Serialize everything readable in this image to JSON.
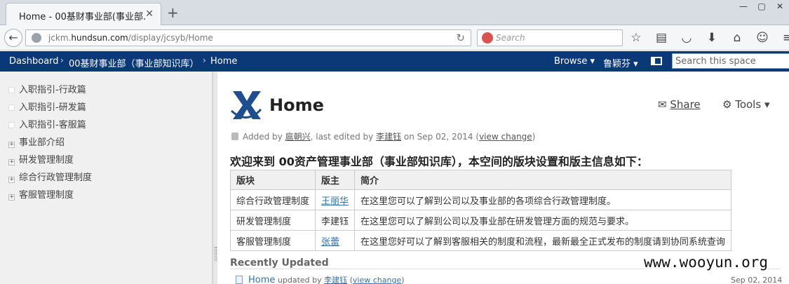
{
  "browser": {
    "tab_title": "Home - 00基财事业部(事业部...",
    "tab_close": "✕",
    "new_tab": "+",
    "url_prefix": "jckm.",
    "url_domain": "hundsun.com",
    "url_path": "/display/jcsyb/Home",
    "search_placeholder": "Search",
    "back_icon": "←",
    "reload_icon": "↻"
  },
  "header": {
    "breadcrumbs": [
      "Dashboard",
      "00基财事业部（事业部知识库）",
      "Home"
    ],
    "breadcrumb_sep": "›",
    "browse_label": "Browse ▾",
    "user_label": "鲁颖芬 ▾",
    "search_placeholder": "Search this space"
  },
  "sidebar": {
    "items": [
      {
        "label": "入职指引-行政篇",
        "marker": ""
      },
      {
        "label": "入职指引-研发篇",
        "marker": ""
      },
      {
        "label": "入职指引-客服篇",
        "marker": ""
      },
      {
        "label": "事业部介绍",
        "marker": "+"
      },
      {
        "label": "研发管理制度",
        "marker": "+"
      },
      {
        "label": "综合行政管理制度",
        "marker": "+"
      },
      {
        "label": "客服管理制度",
        "marker": "+"
      }
    ]
  },
  "page": {
    "title": "Home",
    "share_label": "Share",
    "tools_label": "Tools ▾",
    "meta_added": "Added by ",
    "meta_author": "扈朝兴",
    "meta_edited": ", last edited by ",
    "meta_editor": "李建钰",
    "meta_date": " on Sep 02, 2014  (",
    "meta_view_change": "view change",
    "meta_close": ")",
    "heading": "欢迎来到 00资产管理事业部（事业部知识库），本空间的版块设置和版主信息如下："
  },
  "table": {
    "headers": [
      "版块",
      "版主",
      "简介"
    ],
    "rows": [
      {
        "section": "综合行政管理制度",
        "moderator": "王丽华",
        "linked": true,
        "intro": "在这里您可以了解到公司以及事业部的各项综合行政管理制度。"
      },
      {
        "section": "研发管理制度",
        "moderator": "李建钰",
        "linked": false,
        "intro": "在这里您可以了解到公司以及事业部在研发管理方面的规范与要求。"
      },
      {
        "section": "客服管理制度",
        "moderator": "张蕾",
        "linked": true,
        "intro": "在这里您好可以了解到客服相关的制度和流程，最新最全正式发布的制度请到协同系统查询"
      }
    ]
  },
  "recent": {
    "title": "Recently Updated",
    "page": "Home",
    "updated_by": " updated by ",
    "user": "李建钰",
    "view_change": "view change",
    "date": "Sep 02, 2014"
  },
  "watermark": "www.wooyun.org",
  "colors": {
    "header_bg": "#0b3876",
    "link": "#3572b0"
  }
}
